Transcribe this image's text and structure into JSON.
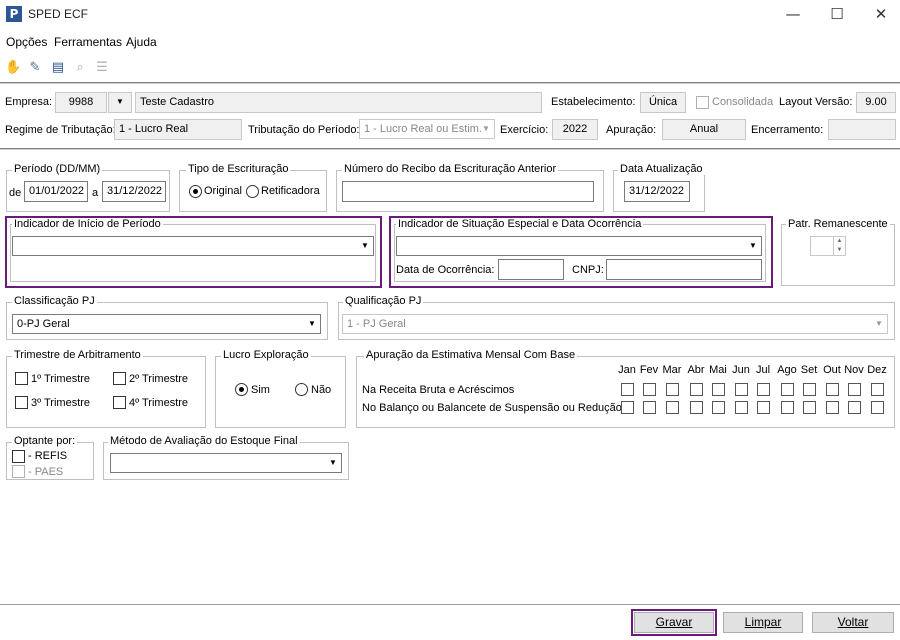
{
  "window": {
    "title": "SPED ECF",
    "app_icon_glyph": "P",
    "controls": {
      "minimize": "—",
      "maximize": "☐",
      "close": "✕"
    }
  },
  "menu": [
    "Opções",
    "Ferramentas",
    "Ajuda"
  ],
  "toolbar_icons": [
    "hand-icon",
    "edit-icon",
    "document-icon",
    "search-doc-icon",
    "list-icon"
  ],
  "header": {
    "empresa_label": "Empresa:",
    "empresa_code": "9988",
    "empresa_name": "Teste Cadastro",
    "estabelecimento_label": "Estabelecimento:",
    "estabelecimento_value": "Única",
    "consolidada_label": "Consolidada",
    "layout_label": "Layout Versão:",
    "layout_value": "9.00",
    "regime_label": "Regime de Tributação:",
    "regime_value": "1 - Lucro Real",
    "tributacao_label": "Tributação do Período:",
    "tributacao_value": "1 - Lucro Real ou Estim.",
    "exercicio_label": "Exercício:",
    "exercicio_value": "2022",
    "apuracao_label": "Apuração:",
    "apuracao_value": "Anual",
    "encerramento_label": "Encerramento:",
    "encerramento_value": ""
  },
  "periodo": {
    "title": "Período (DD/MM)",
    "de_label": "de",
    "de_value": "01/01/2022",
    "a_label": "a",
    "a_value": "31/12/2022"
  },
  "tipo_escrituracao": {
    "title": "Tipo de Escrituração",
    "original": "Original",
    "retificadora": "Retificadora",
    "selected": "Original"
  },
  "recibo": {
    "title": "Número do Recibo da Escrituração Anterior",
    "value": ""
  },
  "data_atualizacao": {
    "title": "Data Atualização",
    "value": "31/12/2022"
  },
  "indicador_inicio": {
    "title": "Indicador de Início de Período",
    "value": ""
  },
  "indicador_situacao": {
    "title": "Indicador de Situação Especial e Data Ocorrência",
    "value": "",
    "data_label": "Data de Ocorrência:",
    "data_value": "",
    "cnpj_label": "CNPJ:",
    "cnpj_value": ""
  },
  "patr_remanescente": {
    "title": "Patr. Remanescente",
    "value": ""
  },
  "classificacao": {
    "title": "Classificação PJ",
    "value": "0-PJ Geral"
  },
  "qualificacao": {
    "title": "Qualificação PJ",
    "value": "1 - PJ Geral"
  },
  "trimestre": {
    "title": "Trimestre de Arbitramento",
    "t1": "1º Trimestre",
    "t2": "2º Trimestre",
    "t3": "3º Trimestre",
    "t4": "4º Trimestre"
  },
  "lucro_exploracao": {
    "title": "Lucro Exploração",
    "sim": "Sim",
    "nao": "Não",
    "selected": "Sim"
  },
  "estimativa": {
    "title": "Apuração da Estimativa Mensal Com Base",
    "months": [
      "Jan",
      "Fev",
      "Mar",
      "Abr",
      "Mai",
      "Jun",
      "Jul",
      "Ago",
      "Set",
      "Out",
      "Nov",
      "Dez"
    ],
    "row1": "Na Receita Bruta e Acréscimos",
    "row2": "No Balanço ou Balancete de Suspensão ou Redução"
  },
  "optante": {
    "title": "Optante por:",
    "refis": "- REFIS",
    "paes": "- PAES"
  },
  "metodo": {
    "title": "Método de Avaliação do Estoque Final",
    "value": ""
  },
  "buttons": {
    "gravar": "Gravar",
    "limpar": "Limpar",
    "voltar": "Voltar"
  }
}
